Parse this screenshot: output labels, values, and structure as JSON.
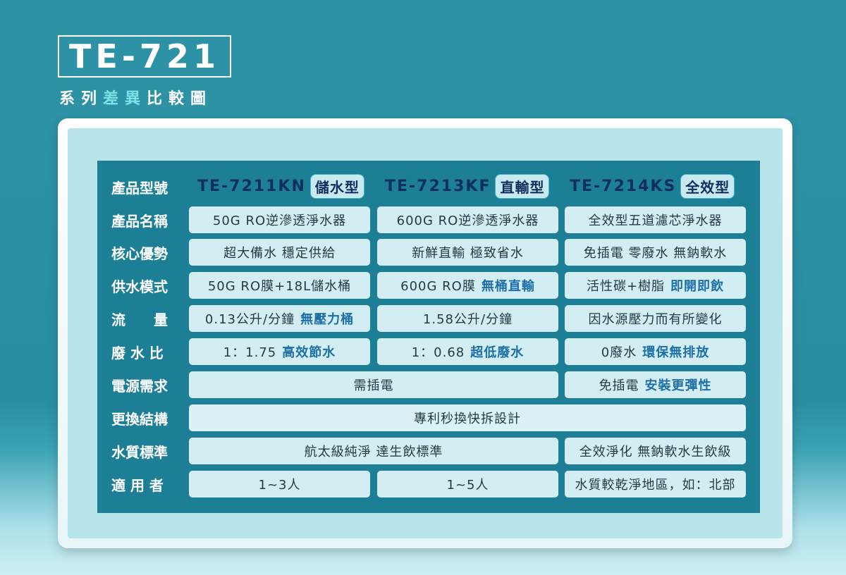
{
  "header": {
    "model": "TE-721",
    "subtitle_a": "系列",
    "subtitle_b": "差異",
    "subtitle_c": "比較圖"
  },
  "colors": {
    "background": "#2f93a6",
    "panel": "#1c7f96",
    "cell": "#d3eef2",
    "header_text": "#0f2f5e",
    "emphasis": "#1e6fa8"
  },
  "table": {
    "row_labels": [
      "產品型號",
      "產品名稱",
      "核心優勢",
      "供水模式",
      "流　　量",
      "廢 水 比",
      "電源需求",
      "更換結構",
      "水質標準",
      "適 用 者"
    ],
    "columns": [
      {
        "model": "TE-7211KN",
        "tag": "儲水型"
      },
      {
        "model": "TE-7213KF",
        "tag": "直輸型"
      },
      {
        "model": "TE-7214KS",
        "tag": "全效型"
      }
    ],
    "rows": {
      "name": [
        "50G RO逆滲透淨水器",
        "600G RO逆滲透淨水器",
        "全效型五道濾芯淨水器"
      ],
      "advantage": [
        "超大備水 穩定供給",
        "新鮮直輸 極致省水",
        "免插電 零廢水 無鈉軟水"
      ],
      "supply": [
        {
          "text": "50G RO膜+18L儲水桶",
          "em": ""
        },
        {
          "text": "600G RO膜",
          "em": "無桶直輸"
        },
        {
          "text": "活性碳+樹脂",
          "em": "即開即飲"
        }
      ],
      "flow": [
        {
          "text": "0.13公升/分鐘",
          "em": "無壓力桶"
        },
        {
          "text": "1.58公升/分鐘",
          "em": ""
        },
        {
          "text": "因水源壓力而有所變化",
          "em": ""
        }
      ],
      "waste": [
        {
          "text": "1：1.75",
          "em": "高效節水"
        },
        {
          "text": "1：0.68",
          "em": "超低廢水"
        },
        {
          "text": "0廢水",
          "em": "環保無排放"
        }
      ],
      "power": [
        {
          "text": "需插電",
          "em": ""
        },
        {
          "text": "免插電",
          "em": "安裝更彈性"
        }
      ],
      "replace": "專利秒換快拆設計",
      "quality": [
        "航太級純淨  達生飲標準",
        "全效淨化 無鈉軟水生飲級"
      ],
      "users": [
        "1~3人",
        "1~5人",
        "水質較乾淨地區，如：北部"
      ]
    }
  }
}
